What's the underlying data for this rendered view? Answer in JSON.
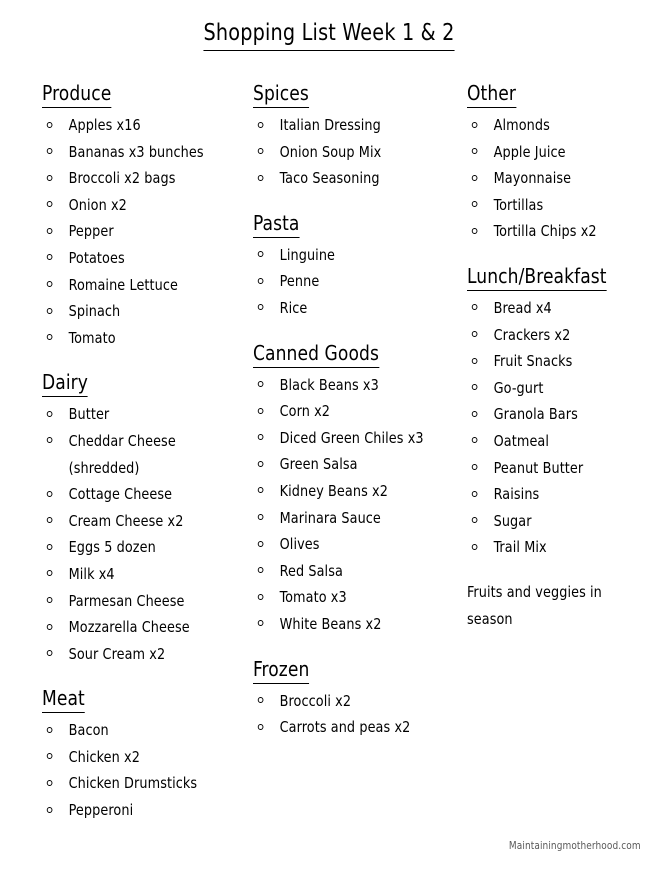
{
  "document": {
    "title": "Shopping List Week 1 & 2",
    "footer_credit": "Maintainingmotherhood.com",
    "bullet_glyph": "hollow-circle",
    "text_color": "#000000",
    "background_color": "#ffffff",
    "footer_color": "#5a5a5a"
  },
  "columns": [
    {
      "id": "column-left",
      "sections": [
        {
          "heading": "Produce",
          "items": [
            "Apples x16",
            "Bananas x3 bunches",
            "Broccoli x2 bags",
            "Onion x2",
            "Pepper",
            "Potatoes",
            "Romaine Lettuce",
            "Spinach",
            "Tomato"
          ]
        },
        {
          "heading": "Dairy",
          "items": [
            "Butter",
            "Cheddar Cheese (shredded)",
            "Cottage Cheese",
            "Cream Cheese x2",
            "Eggs 5 dozen",
            "Milk x4",
            "Parmesan Cheese",
            "Mozzarella Cheese",
            "Sour Cream x2"
          ]
        },
        {
          "heading": "Meat",
          "items": [
            "Bacon",
            "Chicken x2",
            "Chicken Drumsticks",
            "Pepperoni"
          ]
        }
      ]
    },
    {
      "id": "column-middle",
      "sections": [
        {
          "heading": "Spices",
          "items": [
            "Italian Dressing",
            "Onion Soup Mix",
            "Taco Seasoning"
          ]
        },
        {
          "heading": "Pasta",
          "items": [
            "Linguine",
            "Penne",
            "Rice"
          ]
        },
        {
          "heading": "Canned Goods",
          "items": [
            "Black Beans x3",
            "Corn x2",
            "Diced Green Chiles x3",
            "Green Salsa",
            "Kidney Beans x2",
            "Marinara Sauce",
            "Olives",
            "Red Salsa",
            "Tomato x3",
            "White Beans x2"
          ]
        },
        {
          "heading": "Frozen",
          "items": [
            "Broccoli x2",
            "Carrots and peas x2"
          ]
        }
      ]
    },
    {
      "id": "column-right",
      "sections": [
        {
          "heading": "Other",
          "items": [
            "Almonds",
            "Apple Juice",
            "Mayonnaise",
            "Tortillas",
            "Tortilla Chips x2"
          ]
        },
        {
          "heading": "Lunch/Breakfast",
          "items": [
            "Bread x4",
            "Crackers x2",
            "Fruit Snacks",
            "Go-gurt",
            "Granola Bars",
            "Oatmeal",
            "Peanut Butter",
            "Raisins",
            "Sugar",
            "Trail Mix"
          ],
          "note": "Fruits and veggies in season"
        }
      ]
    }
  ]
}
